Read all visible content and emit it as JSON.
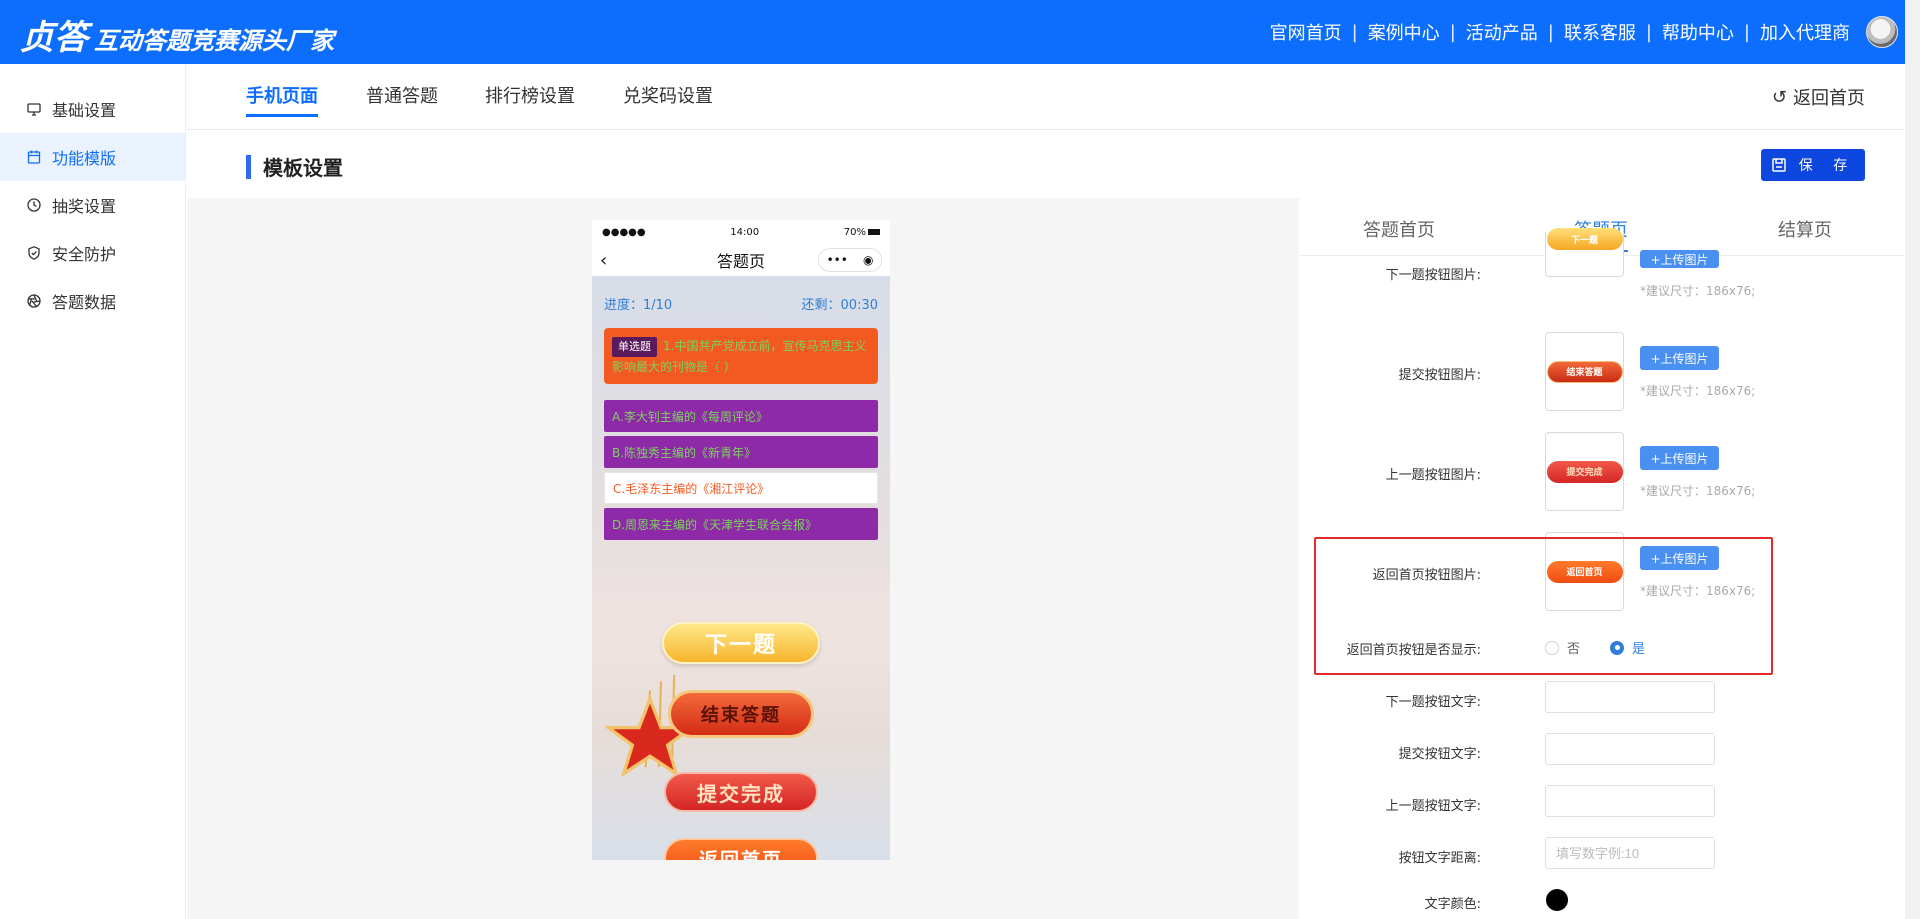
{
  "header": {
    "logo_main": "贞答",
    "logo_sub": "互动答题竞赛源头厂家",
    "nav": [
      "官网首页",
      "案例中心",
      "活动产品",
      "联系客服",
      "帮助中心",
      "加入代理商"
    ],
    "separator": "|"
  },
  "sidebar": {
    "items": [
      {
        "label": "基础设置",
        "icon": "monitor-icon"
      },
      {
        "label": "功能模版",
        "icon": "calendar-icon",
        "active": true
      },
      {
        "label": "抽奖设置",
        "icon": "clock-icon"
      },
      {
        "label": "安全防护",
        "icon": "shield-icon"
      },
      {
        "label": "答题数据",
        "icon": "aperture-icon"
      }
    ]
  },
  "tabs": {
    "items": [
      "手机页面",
      "普通答题",
      "排行榜设置",
      "兑奖码设置"
    ],
    "active": "手机页面",
    "back_label": "返回首页"
  },
  "section": {
    "title": "模板设置",
    "save_label": "保 存"
  },
  "phone": {
    "status_signal": "●●●●●",
    "status_time": "14:00",
    "status_battery": "70%",
    "nav_title": "答题页",
    "progress": "进度：1/10",
    "remaining": "还剩：00:30",
    "question_type": "单选题",
    "question_text": "1.中国共产党成立前，宣传马克思主义影响最大的刊物是（ ）",
    "options": [
      "A.李大钊主编的《每周评论》",
      "B.陈独秀主编的《新青年》",
      "C.毛泽东主编的《湘江评论》",
      "D.周恩来主编的《天津学生联合会报》"
    ],
    "buttons": {
      "next": "下一题",
      "end": "结束答题",
      "submit": "提交完成",
      "home": "返回首页"
    }
  },
  "settings": {
    "tabs": [
      "答题首页",
      "答题页",
      "结算页"
    ],
    "active_tab": "答题页",
    "upload_label": "+上传图片",
    "size_hint": "*建议尺寸：186x76;",
    "image_rows": [
      {
        "label": "下一题按钮图片:",
        "thumb_text": "下一题"
      },
      {
        "label": "提交按钮图片:",
        "thumb_text": "结束答题"
      },
      {
        "label": "上一题按钮图片:",
        "thumb_text": "提交完成"
      },
      {
        "label": "返回首页按钮图片:",
        "thumb_text": "返回首页"
      }
    ],
    "show_home": {
      "label": "返回首页按钮是否显示:",
      "options": [
        "否",
        "是"
      ],
      "selected": "是"
    },
    "text_rows": [
      {
        "label": "下一题按钮文字:",
        "value": "",
        "placeholder": ""
      },
      {
        "label": "提交按钮文字:",
        "value": "",
        "placeholder": ""
      },
      {
        "label": "上一题按钮文字:",
        "value": "",
        "placeholder": ""
      },
      {
        "label": "按钮文字距离:",
        "value": "",
        "placeholder": "填写数字例:10"
      }
    ],
    "text_color_label": "文字颜色:",
    "text_color": "#000000"
  },
  "colors": {
    "brand": "#0d6efd",
    "highlight": "#e52b2b"
  }
}
